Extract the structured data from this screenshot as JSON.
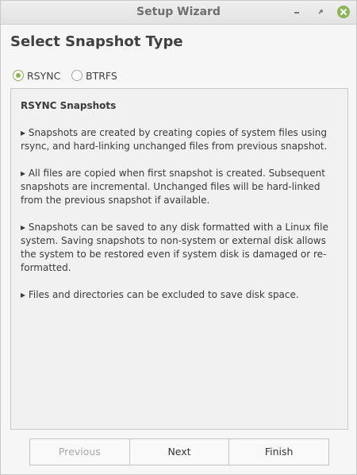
{
  "window": {
    "title": "Setup Wizard"
  },
  "page": {
    "heading": "Select Snapshot Type"
  },
  "snapshot_type": {
    "options": [
      {
        "label": "RSYNC",
        "selected": true
      },
      {
        "label": "BTRFS",
        "selected": false
      }
    ]
  },
  "info": {
    "title": "RSYNC Snapshots",
    "paragraphs": [
      "▸ Snapshots are created by creating copies of system files using rsync, and hard-linking unchanged files from previous snapshot.",
      "▸ All files are copied when first snapshot is created. Subsequent snapshots are incremental. Unchanged files will be hard-linked from the previous snapshot if available.",
      "▸ Snapshots can be saved to any disk formatted with a Linux file system. Saving snapshots to non-system or external disk allows the system to be restored even if system disk is damaged or re-formatted.",
      "▸ Files and directories can be excluded to save disk space."
    ]
  },
  "buttons": {
    "previous": "Previous",
    "next": "Next",
    "finish": "Finish"
  },
  "colors": {
    "accent": "#8fb359"
  }
}
